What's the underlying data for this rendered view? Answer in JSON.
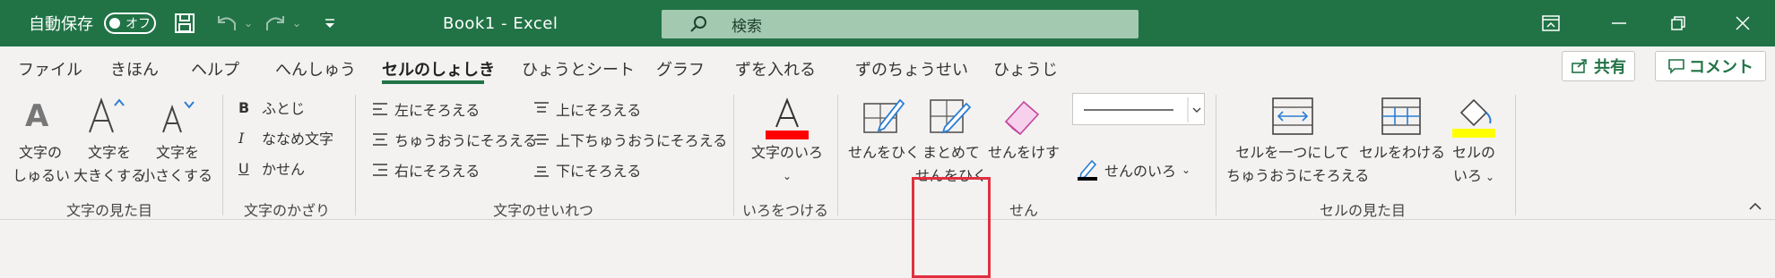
{
  "titlebar": {
    "autosave_label": "自動保存",
    "autosave_toggle": "オフ",
    "doc_title": "Book1  -  Excel",
    "search_placeholder": "検索",
    "bg_color": "#217346"
  },
  "tabs": [
    {
      "label": "ファイル"
    },
    {
      "label": "きほん"
    },
    {
      "label": "ヘルプ"
    },
    {
      "label": "へんしゅう"
    },
    {
      "label": "セルのしょしき"
    },
    {
      "label": "ひょうとシート"
    },
    {
      "label": "グラフ"
    },
    {
      "label": "ずを入れる"
    },
    {
      "label": "ずのちょうせい"
    },
    {
      "label": "ひょうじ"
    }
  ],
  "active_tab": "セルのしょしき",
  "share_label": "共有",
  "comment_label": "コメント",
  "groups": {
    "font_look": {
      "label": "文字の見た目",
      "kind_line1": "文字の",
      "kind_line2": "しゅるい",
      "bigger_line1": "文字を",
      "bigger_line2": "大きくする",
      "smaller_line1": "文字を",
      "smaller_line2": "小さくする"
    },
    "decoration": {
      "label": "文字のかざり",
      "bold": "ふとじ",
      "italic": "ななめ文字",
      "underline": "かせん"
    },
    "alignment": {
      "label": "文字のせいれつ",
      "left": "左にそろえる",
      "center": "ちゅうおうにそろえる",
      "right": "右にそろえる",
      "top": "上にそろえる",
      "middle": "上下ちゅうおうにそろえる",
      "bottom": "下にそろえる"
    },
    "color": {
      "label": "いろをつける",
      "font_color": "文字のいろ",
      "accent": "#ff0000"
    },
    "border": {
      "label": "せん",
      "draw": "せんをひく",
      "draw_all_line1": "まとめて",
      "draw_all_line2": "せんをひく",
      "erase": "せんをけす",
      "line_color": "せんのいろ"
    },
    "cell_look": {
      "label": "セルの見た目",
      "merge_line1": "セルを一つにして",
      "merge_line2": "ちゅうおうにそろえる",
      "split": "セルをわける",
      "fill_line1": "セルの",
      "fill_line2": "いろ",
      "fill_accent": "#ffff00"
    }
  }
}
